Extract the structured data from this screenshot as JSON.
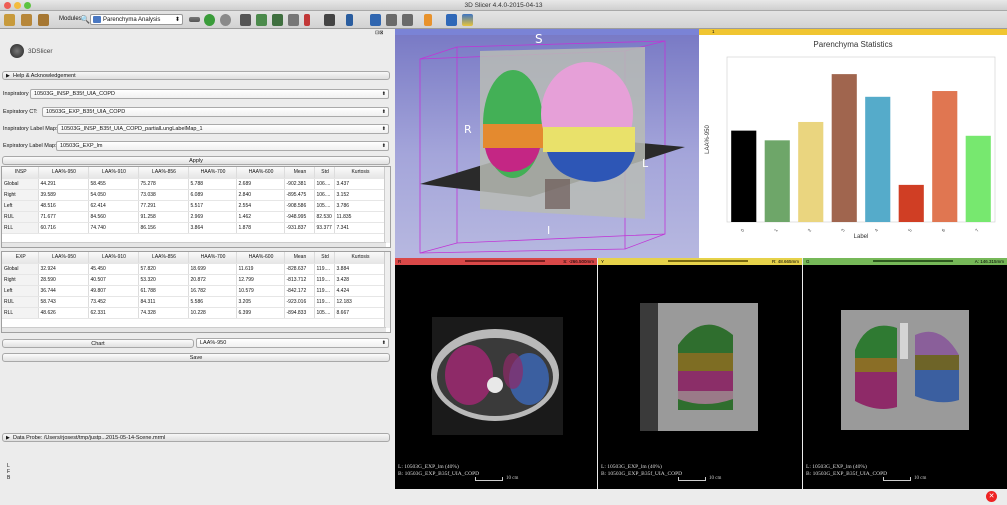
{
  "window": {
    "title": "3D Slicer 4.4.0-2015-04-13"
  },
  "toolbar": {
    "modules_label": "Modules:",
    "module_selected": "Parenchyma Analysis"
  },
  "left": {
    "logo_text": "3DSlicer",
    "help_label": "Help & Acknowledgement",
    "inspiratory_ct_label": "Inspiratory CT:",
    "inspiratory_ct_value": "10503G_INSP_B35f_UIA_COPD",
    "expiratory_ct_label": "Expiratory CT:",
    "expiratory_ct_value": "10503G_EXP_B35f_UIA_COPD",
    "insp_labelmap_label": "Inspiratory Label Map:",
    "insp_labelmap_value": "10503G_INSP_B35f_UIA_COPD_partialLungLabelMap_1",
    "exp_labelmap_label": "Expiratory Label Map:",
    "exp_labelmap_value": "10503G_EXP_lm",
    "apply_label": "Apply",
    "chart_label": "Chart",
    "chart_select": "LAA%-950",
    "save_label": "Save",
    "probe_label": "Data Probe: /Users/rjosest/tmp/justp...2015-05-14-Scene.mrml",
    "probe_lines": [
      "L",
      "F",
      "B"
    ]
  },
  "insp_table": {
    "headers": [
      "INSP",
      "LAA%-950",
      "LAA%-910",
      "LAA%-856",
      "HAA%-700",
      "HAA%-600",
      "Mean",
      "Std",
      "Kurtosis"
    ],
    "rows": [
      [
        "Global",
        "44.291",
        "58.455",
        "75.278",
        "5.788",
        "2.689",
        "-902.381",
        "106....",
        "3.437"
      ],
      [
        "Right",
        "39.589",
        "54.050",
        "73.038",
        "6.089",
        "2.840",
        "-895.475",
        "106....",
        "3.152"
      ],
      [
        "Left",
        "48.516",
        "62.414",
        "77.291",
        "5.517",
        "2.554",
        "-908.586",
        "105....",
        "3.786"
      ],
      [
        "RUL",
        "71.677",
        "84.560",
        "91.258",
        "2.969",
        "1.462",
        "-948.995",
        "82.530",
        "11.835"
      ],
      [
        "RLL",
        "60.716",
        "74.740",
        "86.156",
        "3.864",
        "1.878",
        "-931.837",
        "93.377",
        "7.341"
      ]
    ]
  },
  "exp_table": {
    "headers": [
      "EXP",
      "LAA%-950",
      "LAA%-910",
      "LAA%-856",
      "HAA%-700",
      "HAA%-600",
      "Mean",
      "Std",
      "Kurtosis"
    ],
    "rows": [
      [
        "Global",
        "32.924",
        "45.450",
        "57.820",
        "18.699",
        "11.619",
        "-828.637",
        "119....",
        "3.884"
      ],
      [
        "Right",
        "28.590",
        "40.507",
        "53.320",
        "20.872",
        "12.799",
        "-813.712",
        "119....",
        "3.428"
      ],
      [
        "Left",
        "36.744",
        "49.807",
        "61.788",
        "16.782",
        "10.579",
        "-842.172",
        "119....",
        "4.424"
      ],
      [
        "RUL",
        "58.743",
        "73.452",
        "84.311",
        "5.586",
        "3.205",
        "-923.016",
        "119....",
        "12.183"
      ],
      [
        "RLL",
        "48.626",
        "62.331",
        "74.328",
        "10.228",
        "6.399",
        "-894.833",
        "105....",
        "8.667"
      ]
    ]
  },
  "view3d": {
    "S": "S",
    "R": "R",
    "L": "L",
    "I": "I"
  },
  "chart_header": "1",
  "chart_data": {
    "type": "bar",
    "title": "Parenchyma Statistics",
    "xlabel": "Label",
    "ylabel": "LAA%-950",
    "categories": [
      "0",
      "1",
      "2",
      "3",
      "4",
      "5",
      "6",
      "7"
    ],
    "values": [
      44.3,
      39.6,
      48.5,
      71.7,
      60.7,
      18.0,
      63.5,
      41.8
    ],
    "colors": [
      "#000000",
      "#6ea669",
      "#ead57f",
      "#a0654e",
      "#55abca",
      "#d03e24",
      "#e07651",
      "#77e86f"
    ],
    "ylim": [
      0,
      80
    ]
  },
  "slices": [
    {
      "letter": "R",
      "offset": "S: -266.500mm",
      "color": "#e04a4a",
      "info1": "L: 10503G_EXP_lm (40%)",
      "info2": "B: 10503G_EXP_B35f_UIA_COPD",
      "scale": "10 cm"
    },
    {
      "letter": "Y",
      "offset": "R: 48.665mm",
      "color": "#e6d43d",
      "info1": "L: 10503G_EXP_lm (40%)",
      "info2": "B: 10503G_EXP_B35f_UIA_COPD",
      "scale": "10 cm"
    },
    {
      "letter": "G",
      "offset": "A: 146.315mm",
      "color": "#6fbf4f",
      "info1": "L: 10503G_EXP_lm (40%)",
      "info2": "B: 10503G_EXP_B35f_UIA_COPD",
      "scale": "10 cm"
    }
  ]
}
